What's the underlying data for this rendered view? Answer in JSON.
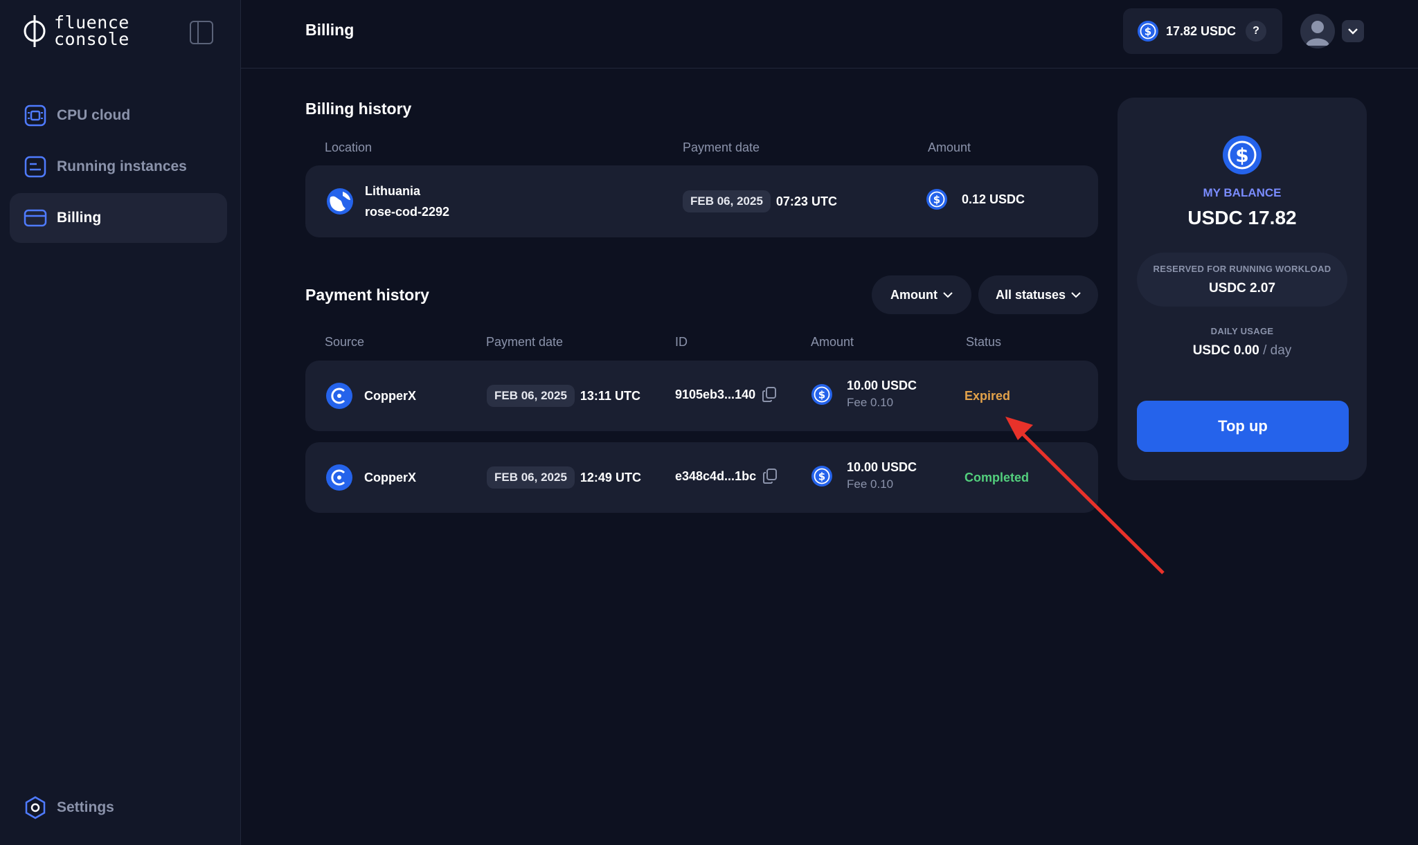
{
  "brand": {
    "line1": "fluence",
    "line2": "console"
  },
  "sidebar": {
    "items": [
      {
        "label": "CPU cloud",
        "icon": "cpu-icon"
      },
      {
        "label": "Running instances",
        "icon": "instances-icon"
      },
      {
        "label": "Billing",
        "icon": "card-icon",
        "active": true
      }
    ],
    "settings_label": "Settings"
  },
  "header": {
    "title": "Billing",
    "balance": "17.82 USDC",
    "help": "?"
  },
  "billing_history": {
    "title": "Billing history",
    "columns": [
      "Location",
      "Payment date",
      "Amount"
    ],
    "rows": [
      {
        "location": "Lithuania",
        "instance": "rose-cod-2292",
        "date": "FEB 06, 2025",
        "time": "07:23 UTC",
        "amount": "0.12 USDC"
      }
    ]
  },
  "payment_history": {
    "title": "Payment history",
    "filters": {
      "amount": "Amount",
      "status": "All statuses"
    },
    "columns": [
      "Source",
      "Payment date",
      "ID",
      "Amount",
      "Status"
    ],
    "rows": [
      {
        "source": "CopperX",
        "date": "FEB 06, 2025",
        "time": "13:11 UTC",
        "id": "9105eb3...140",
        "amount": "10.00 USDC",
        "fee": "Fee 0.10",
        "status": "Expired"
      },
      {
        "source": "CopperX",
        "date": "FEB 06, 2025",
        "time": "12:49 UTC",
        "id": "e348c4d...1bc",
        "amount": "10.00 USDC",
        "fee": "Fee 0.10",
        "status": "Completed"
      }
    ]
  },
  "balance_panel": {
    "label": "MY BALANCE",
    "value": "USDC 17.82",
    "reserved_label": "RESERVED FOR RUNNING WORKLOAD",
    "reserved_value": "USDC 2.07",
    "daily_label": "DAILY USAGE",
    "daily_value": "USDC 0.00",
    "daily_unit": "/ day",
    "topup_label": "Top up"
  },
  "colors": {
    "background": "#0d1120",
    "card": "#1a1f31",
    "accent": "#2563eb",
    "expired": "#e3a24a",
    "completed": "#53cf7d",
    "annotation_arrow": "#e8322a"
  }
}
